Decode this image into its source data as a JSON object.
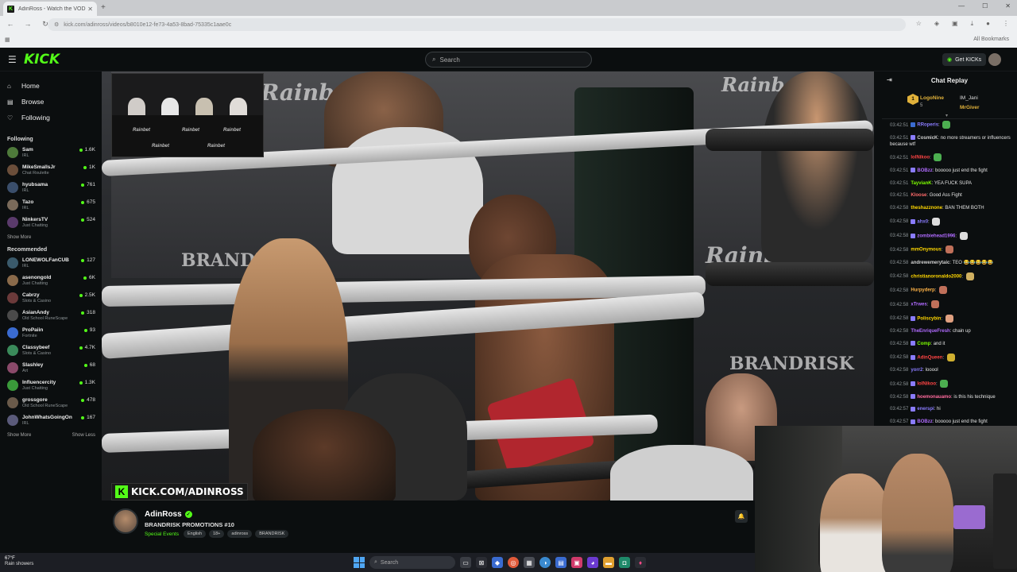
{
  "browser": {
    "tab_title": "AdinRoss - Watch the VOD",
    "url": "kick.com/adinross/videos/b8010e12-fe73-4a53-8bad-75335c1aae0c",
    "bookmarks_label": "All Bookmarks"
  },
  "header": {
    "logo": "KICK",
    "search_placeholder": "Search",
    "get_kicks_label": "Get KICKs"
  },
  "sidebar": {
    "nav": [
      {
        "label": "Home",
        "icon": "home-icon"
      },
      {
        "label": "Browse",
        "icon": "browse-icon"
      },
      {
        "label": "Following",
        "icon": "heart-icon"
      }
    ],
    "following_title": "Following",
    "following": [
      {
        "name": "Sam",
        "category": "IRL",
        "viewers": "1.6K",
        "color": "#4e7a3a"
      },
      {
        "name": "MikeSmallsJr",
        "category": "Chat Roulette",
        "viewers": "1K",
        "color": "#6b4e3a"
      },
      {
        "name": "hyubsama",
        "category": "IRL",
        "viewers": "761",
        "color": "#3a4e6b"
      },
      {
        "name": "Tazo",
        "category": "IRL",
        "viewers": "675",
        "color": "#7a6a5a"
      },
      {
        "name": "NinkersTV",
        "category": "Just Chatting",
        "viewers": "524",
        "color": "#5a3a6b"
      }
    ],
    "show_more": "Show More",
    "recommended_title": "Recommended",
    "recommended": [
      {
        "name": "LONEWOLFanCUB",
        "category": "IRL",
        "viewers": "127",
        "color": "#3a5a6b"
      },
      {
        "name": "asenongold",
        "category": "Just Chatting",
        "viewers": "6K",
        "color": "#8a6a4a"
      },
      {
        "name": "Cabrzy",
        "category": "Slots & Casino",
        "viewers": "2.5K",
        "color": "#6b3a3a"
      },
      {
        "name": "AsianAndy",
        "category": "Old School RuneScape",
        "viewers": "318",
        "color": "#4a4a4a"
      },
      {
        "name": "ProPaiin",
        "category": "Fortnite",
        "viewers": "93",
        "color": "#3a6bd0"
      },
      {
        "name": "Classybeef",
        "category": "Slots & Casino",
        "viewers": "4.7K",
        "color": "#3a8a5a"
      },
      {
        "name": "Slashley",
        "category": "Art",
        "viewers": "68",
        "color": "#8a4a6a"
      },
      {
        "name": "Influencercity",
        "category": "Just Chatting",
        "viewers": "1.3K",
        "color": "#3a9a3a"
      },
      {
        "name": "grossgore",
        "category": "Old School RuneScape",
        "viewers": "478",
        "color": "#6a5a4a"
      },
      {
        "name": "JohnWhatsGoingOn",
        "category": "IRL",
        "viewers": "167",
        "color": "#5a5a7a"
      }
    ],
    "show_less": "Show Less"
  },
  "video": {
    "overlay_url": "KICK.COM/ADINROSS",
    "banner": "Rainbet",
    "banner2": "BRANDRISK"
  },
  "stream": {
    "streamer": "AdinRoss",
    "title": "BRANDRISK PROMOTIONS #10",
    "category": "Special Events",
    "tags": [
      "English",
      "18+",
      "adinross",
      "BRANDRISK"
    ]
  },
  "chat": {
    "title": "Chat Replay",
    "pinned": {
      "user1": "LogoNine",
      "user1_sub": "5",
      "user2": "IM_Jani",
      "user3": "MrGiver"
    },
    "messages": [
      {
        "ts": "03:42:51",
        "user": "RRoperis",
        "color": "#8a7cff",
        "text": "",
        "badge": "#3a6bd0",
        "emote": "#4caf50"
      },
      {
        "ts": "03:42:51",
        "user": "CosmicK",
        "color": "#cfcfcf",
        "text": "no more streamers or influencers because wtf",
        "badge": "#8a7cff"
      },
      {
        "ts": "03:42:51",
        "user": "lolNikoo",
        "color": "#ff4444",
        "text": "",
        "badge": "",
        "emote": "#4caf50"
      },
      {
        "ts": "03:42:51",
        "user": "BOBzz",
        "color": "#b06bff",
        "text": "booooo just end the fight",
        "badge": "#8a7cff"
      },
      {
        "ts": "03:42:51",
        "user": "TayvianK",
        "color": "#7cfc00",
        "text": "YEA FUCK SUPA",
        "badge": ""
      },
      {
        "ts": "03:42:51",
        "user": "Kloose",
        "color": "#ff6b6b",
        "text": "Good Ass Fight",
        "badge": ""
      },
      {
        "ts": "03:42:58",
        "user": "theshazznone",
        "color": "#ffd700",
        "text": "BAN THEM BOTH",
        "badge": ""
      },
      {
        "ts": "03:42:58",
        "user": "ahx0",
        "color": "#8a7cff",
        "text": "",
        "badge": "#8a7cff",
        "emote": "#ddd"
      },
      {
        "ts": "03:42:58",
        "user": "zombiehead1996",
        "color": "#b06bff",
        "text": "",
        "badge": "#8a7cff",
        "emote": "#ddd"
      },
      {
        "ts": "03:42:58",
        "user": "mmOnymous",
        "color": "#ffd700",
        "text": "",
        "badge": "",
        "emote": "#c0705a"
      },
      {
        "ts": "03:42:58",
        "user": "andrewemerytaic",
        "color": "#cfcfcf",
        "text": "TEO 😂😂😂😂😂",
        "badge": ""
      },
      {
        "ts": "03:42:58",
        "user": "christianoronaldo2000",
        "color": "#ffd700",
        "text": "",
        "badge": "",
        "emote": "#d0b060"
      },
      {
        "ts": "03:42:58",
        "user": "Hurpyderp",
        "color": "#ffb347",
        "text": "",
        "badge": "",
        "emote": "#c0705a"
      },
      {
        "ts": "03:42:58",
        "user": "xTrwes",
        "color": "#b06bff",
        "text": "",
        "badge": "",
        "emote": "#c0705a"
      },
      {
        "ts": "03:42:58",
        "user": "Poliscybin",
        "color": "#ffd700",
        "text": "",
        "badge": "#8a7cff",
        "emote": "#e0a080"
      },
      {
        "ts": "03:42:58",
        "user": "TheEnriqueFresh",
        "color": "#b06bff",
        "text": "chain up",
        "badge": ""
      },
      {
        "ts": "03:42:58",
        "user": "Comp",
        "color": "#7cfc00",
        "text": "and it",
        "badge": "#8a7cff"
      },
      {
        "ts": "03:42:58",
        "user": "AdinQueen",
        "color": "#ff4444",
        "text": "",
        "badge": "#8a7cff",
        "emote": "#d0b030"
      },
      {
        "ts": "03:42:58",
        "user": "yorr2",
        "color": "#8a7cff",
        "text": "looool",
        "badge": ""
      },
      {
        "ts": "03:42:58",
        "user": "lolNikoo",
        "color": "#ff4444",
        "text": "",
        "badge": "#8a7cff",
        "emote": "#4caf50"
      },
      {
        "ts": "03:42:58",
        "user": "hoemonauamo",
        "color": "#ff6b9e",
        "text": "is this his technique",
        "badge": "#8a7cff"
      },
      {
        "ts": "03:42:57",
        "user": "enerspi",
        "color": "#8a7cff",
        "text": "hi",
        "badge": "#8a7cff"
      },
      {
        "ts": "03:42:57",
        "user": "BOBzz",
        "color": "#b06bff",
        "text": "booooo just end the fight",
        "badge": "#8a7cff"
      }
    ]
  },
  "taskbar": {
    "temp": "67°F",
    "weather": "Rain showers",
    "search_placeholder": "Search"
  }
}
